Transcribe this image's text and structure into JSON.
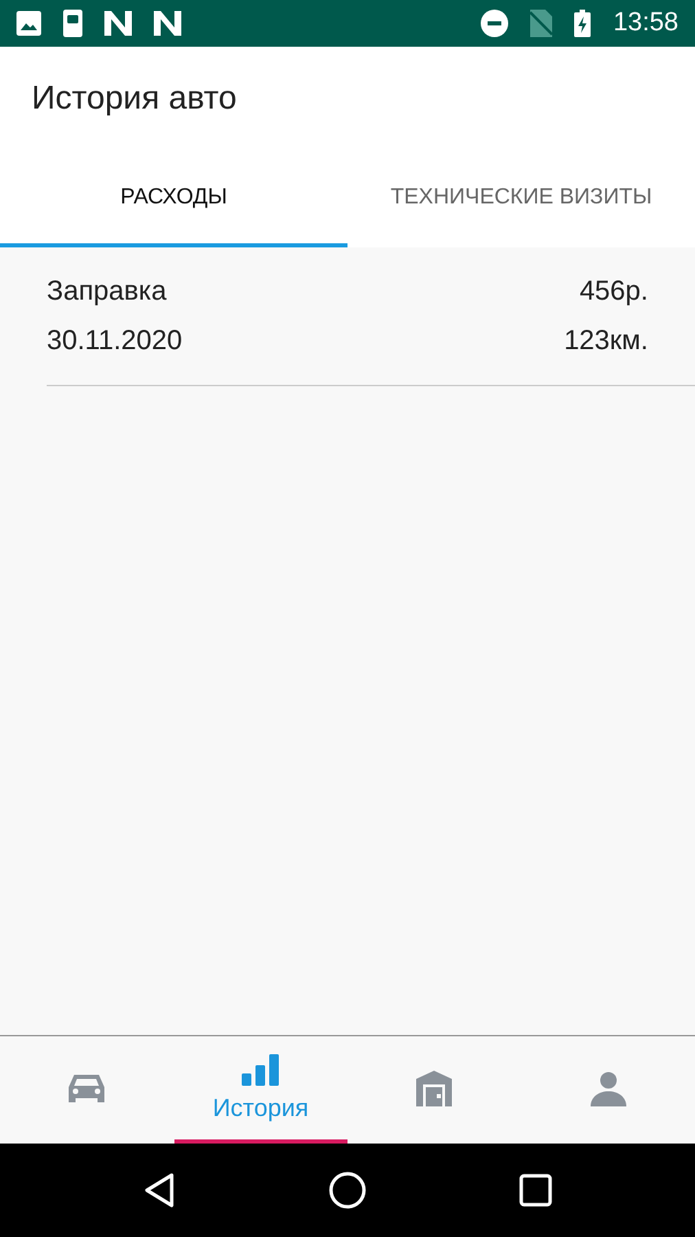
{
  "status_bar": {
    "time": "13:58"
  },
  "app_bar": {
    "title": "История авто"
  },
  "tabs": [
    {
      "label": "РАСХОДЫ",
      "selected": true
    },
    {
      "label": "ТЕХНИЧЕСКИЕ ВИЗИТЫ",
      "selected": false
    }
  ],
  "entries": [
    {
      "name": "Заправка",
      "amount": "456р.",
      "date": "30.11.2020",
      "mileage": "123км."
    }
  ],
  "bottom_nav": [
    {
      "kind": "car",
      "selected": false
    },
    {
      "kind": "history",
      "label": "История",
      "selected": true
    },
    {
      "kind": "garage",
      "selected": false
    },
    {
      "kind": "profile",
      "selected": false
    }
  ]
}
